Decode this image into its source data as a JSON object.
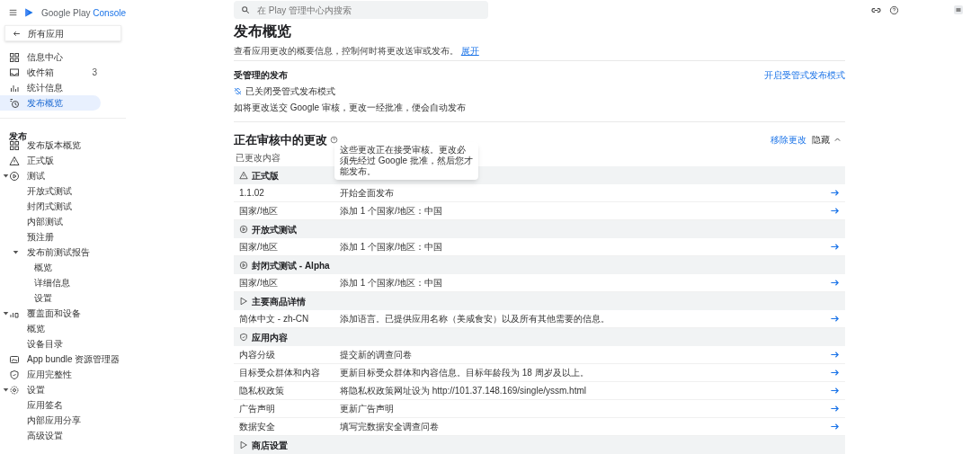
{
  "header": {
    "logo_main": "Google Play",
    "logo_accent": "Console",
    "search": {
      "placeholder": "在 Play 管理中心内搜索"
    }
  },
  "sidebar": {
    "back": "所有应用",
    "top_items": [
      {
        "label": "信息中心",
        "selected": false
      },
      {
        "label": "收件箱",
        "badge": "3",
        "selected": false
      },
      {
        "label": "统计信息",
        "selected": false
      },
      {
        "label": "发布概览",
        "selected": true
      }
    ],
    "section_title": "发布",
    "items": [
      {
        "label": "发布版本概览",
        "selected": false
      },
      {
        "label": "正式版",
        "selected": false
      },
      {
        "label": "测试",
        "selected": false,
        "expanded": true,
        "children": [
          {
            "label": "开放式测试",
            "selected": false
          },
          {
            "label": "封闭式测试",
            "selected": false
          },
          {
            "label": "内部测试",
            "selected": false
          },
          {
            "label": "预注册",
            "selected": false
          },
          {
            "label": "发布前测试报告",
            "selected": false,
            "expanded": true,
            "children": [
              {
                "label": "概览",
                "selected": false
              },
              {
                "label": "详细信息",
                "selected": false
              },
              {
                "label": "设置",
                "selected": false
              }
            ]
          }
        ]
      },
      {
        "label": "覆盖面和设备",
        "selected": false,
        "expanded": true,
        "children": [
          {
            "label": "概览",
            "selected": false
          },
          {
            "label": "设备目录",
            "selected": false
          }
        ]
      },
      {
        "label": "App bundle 资源管理器",
        "selected": false
      },
      {
        "label": "应用完整性",
        "selected": false
      },
      {
        "label": "设置",
        "selected": false,
        "expanded": true,
        "children": [
          {
            "label": "应用签名",
            "selected": false
          },
          {
            "label": "内部应用分享",
            "selected": false
          },
          {
            "label": "高级设置",
            "selected": false
          }
        ]
      }
    ]
  },
  "page": {
    "title": "发布概览",
    "subtitle": "查看应用更改的概要信息，控制何时将更改送审或发布。",
    "subtitle_link": "展开",
    "managed": {
      "title": "受管理的发布",
      "status": "已关闭受管式发布模式",
      "description": "如将更改送交 Google 审核，更改一经批准，便会自动发布",
      "action": "开启受管式发布模式"
    },
    "review": {
      "title": "正在审核中的更改",
      "tooltip": "这些更改正在接受审核。更改必须先经过 Google 批准，然后您才能发布。",
      "remove": "移除更改",
      "toggle": "隐藏",
      "expanded": true,
      "column_header": "已更改内容",
      "rows": [
        {
          "kind": "group",
          "label": "正式版"
        },
        {
          "kind": "change",
          "item": "1.1.02",
          "change": "开始全面发布"
        },
        {
          "kind": "change",
          "item": "国家/地区",
          "change": "添加 1 个国家/地区：中国"
        },
        {
          "kind": "group",
          "label": "开放式测试"
        },
        {
          "kind": "change",
          "item": "国家/地区",
          "change": "添加 1 个国家/地区：中国"
        },
        {
          "kind": "group",
          "label": "封闭式测试 - Alpha"
        },
        {
          "kind": "change",
          "item": "国家/地区",
          "change": "添加 1 个国家/地区：中国"
        },
        {
          "kind": "group",
          "label": "主要商品详情"
        },
        {
          "kind": "change",
          "item": "简体中文 - zh-CN",
          "change": "添加语言。已提供应用名称（美咸食安）以及所有其他需要的信息。"
        },
        {
          "kind": "group",
          "label": "应用内容"
        },
        {
          "kind": "change",
          "item": "内容分级",
          "change": "提交新的调查问卷"
        },
        {
          "kind": "change",
          "item": "目标受众群体和内容",
          "change": "更新目标受众群体和内容信息。目标年龄段为 18 周岁及以上。"
        },
        {
          "kind": "change",
          "item": "隐私权政策",
          "change": "将隐私权政策网址设为 http://101.37.148.169/single/yssm.html"
        },
        {
          "kind": "change",
          "item": "广告声明",
          "change": "更新广告声明"
        },
        {
          "kind": "change",
          "item": "数据安全",
          "change": "填写完数据安全调查问卷"
        },
        {
          "kind": "group",
          "label": "商店设置"
        }
      ]
    }
  }
}
